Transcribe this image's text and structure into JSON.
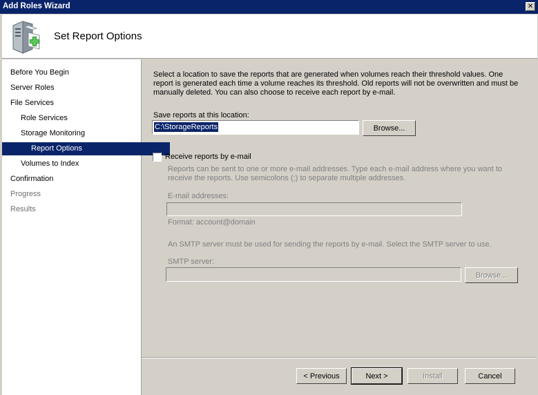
{
  "window": {
    "title": "Add Roles Wizard",
    "close_glyph": "✕"
  },
  "header": {
    "title": "Set Report Options",
    "icon": "server-add-icon"
  },
  "nav": {
    "items": [
      {
        "label": "Before You Begin"
      },
      {
        "label": "Server Roles"
      },
      {
        "label": "File Services"
      },
      {
        "label": "Role Services"
      },
      {
        "label": "Storage Monitoring"
      },
      {
        "label": "Report Options"
      },
      {
        "label": "Volumes to Index"
      },
      {
        "label": "Confirmation"
      },
      {
        "label": "Progress"
      },
      {
        "label": "Results"
      }
    ],
    "selected": "Report Options"
  },
  "main": {
    "description": [
      "Select a location to save the reports that are generated when volumes reach their threshold values. One",
      "report is generated each time a volume reaches its threshold. Old reports will not be overwritten and must be",
      "manually deleted. You can also choose to receive each report by e-mail."
    ],
    "save_label": "Save reports at this location:",
    "save_path": "C:\\StorageReports",
    "browse_label": "Browse...",
    "email_checkbox_label": "Receive reports by e-mail",
    "email_checked": false,
    "email_help": [
      "Reports can be sent to one or more e-mail addresses. Type each e-mail address where you want to",
      "receive the reports. Use semicolons (;) to separate multiple addresses."
    ],
    "email_addresses_label": "E-mail addresses:",
    "email_addresses_value": "",
    "email_format": "Format: account@domain",
    "smtp_help": "An SMTP server must be used for sending the reports by e-mail. Select the SMTP server to use.",
    "smtp_label": "SMTP server:",
    "smtp_value": "",
    "smtp_browse_label": "Browse..."
  },
  "footer": {
    "previous_label": "< Previous",
    "next_label": "Next >",
    "install_label": "Install",
    "cancel_label": "Cancel"
  }
}
